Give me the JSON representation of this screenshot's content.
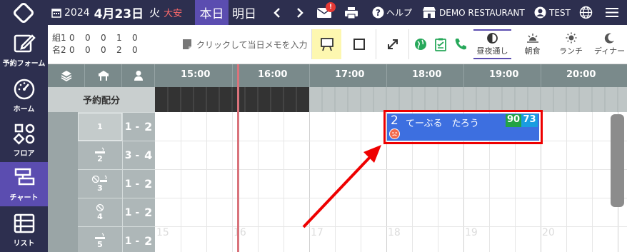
{
  "header": {
    "date_year": "2024",
    "date_month_day": "4月23日",
    "day_of_week": "火",
    "rokuyo": "大安",
    "today_label": "本日",
    "tomorrow_label": "明日",
    "mail_badge": "!",
    "help_label": "ヘルプ",
    "store_name": "DEMO RESTAURANT",
    "user_name": "TEST"
  },
  "nav": [
    {
      "label": "予約フォーム",
      "icon": "edit-icon"
    },
    {
      "label": "ホーム",
      "icon": "dashboard-icon"
    },
    {
      "label": "フロア",
      "icon": "floor-icon"
    },
    {
      "label": "チャート",
      "icon": "chart-icon"
    },
    {
      "label": "リスト",
      "icon": "list-icon"
    }
  ],
  "toolbar": {
    "stats": {
      "row1_label": "組",
      "row2_label": "名",
      "groups": [
        "1",
        "0",
        "0",
        "0",
        "1",
        "0"
      ],
      "people": [
        "2",
        "0",
        "0",
        "0",
        "2",
        "0"
      ]
    },
    "memo_placeholder": "クリックして当日メモを入力",
    "meals": [
      {
        "label": "昼夜通し",
        "active": true
      },
      {
        "label": "朝食",
        "active": false
      },
      {
        "label": "ランチ",
        "active": false
      },
      {
        "label": "ディナー",
        "active": false
      }
    ]
  },
  "chart": {
    "hours": [
      "15:00",
      "16:00",
      "17:00",
      "18:00",
      "19:00",
      "20:00"
    ],
    "allocation_label": "予約配分",
    "tables": [
      {
        "name": "1",
        "cap_min": "1",
        "cap_max": "2"
      },
      {
        "name": "2",
        "cap_min": "3",
        "cap_max": "4"
      },
      {
        "name": "3",
        "cap_min": "1",
        "cap_max": "2"
      },
      {
        "name": "4",
        "cap_min": "1",
        "cap_max": "2"
      },
      {
        "name": "5",
        "cap_min": "1",
        "cap_max": "2"
      }
    ],
    "hour_watermarks": [
      "15",
      "16",
      "17",
      "18",
      "19",
      "20"
    ],
    "reservation": {
      "party_size": "2",
      "guest_name": "てーぶる　たろう",
      "score_1": "90",
      "score_2": "73"
    }
  },
  "colors": {
    "topbar": "#2d2f4f",
    "active_purple": "#5b4db0",
    "reservation_blue": "#3d6fe0",
    "highlight_red": "#e00000",
    "timeline_header": "#7a8a8b"
  }
}
